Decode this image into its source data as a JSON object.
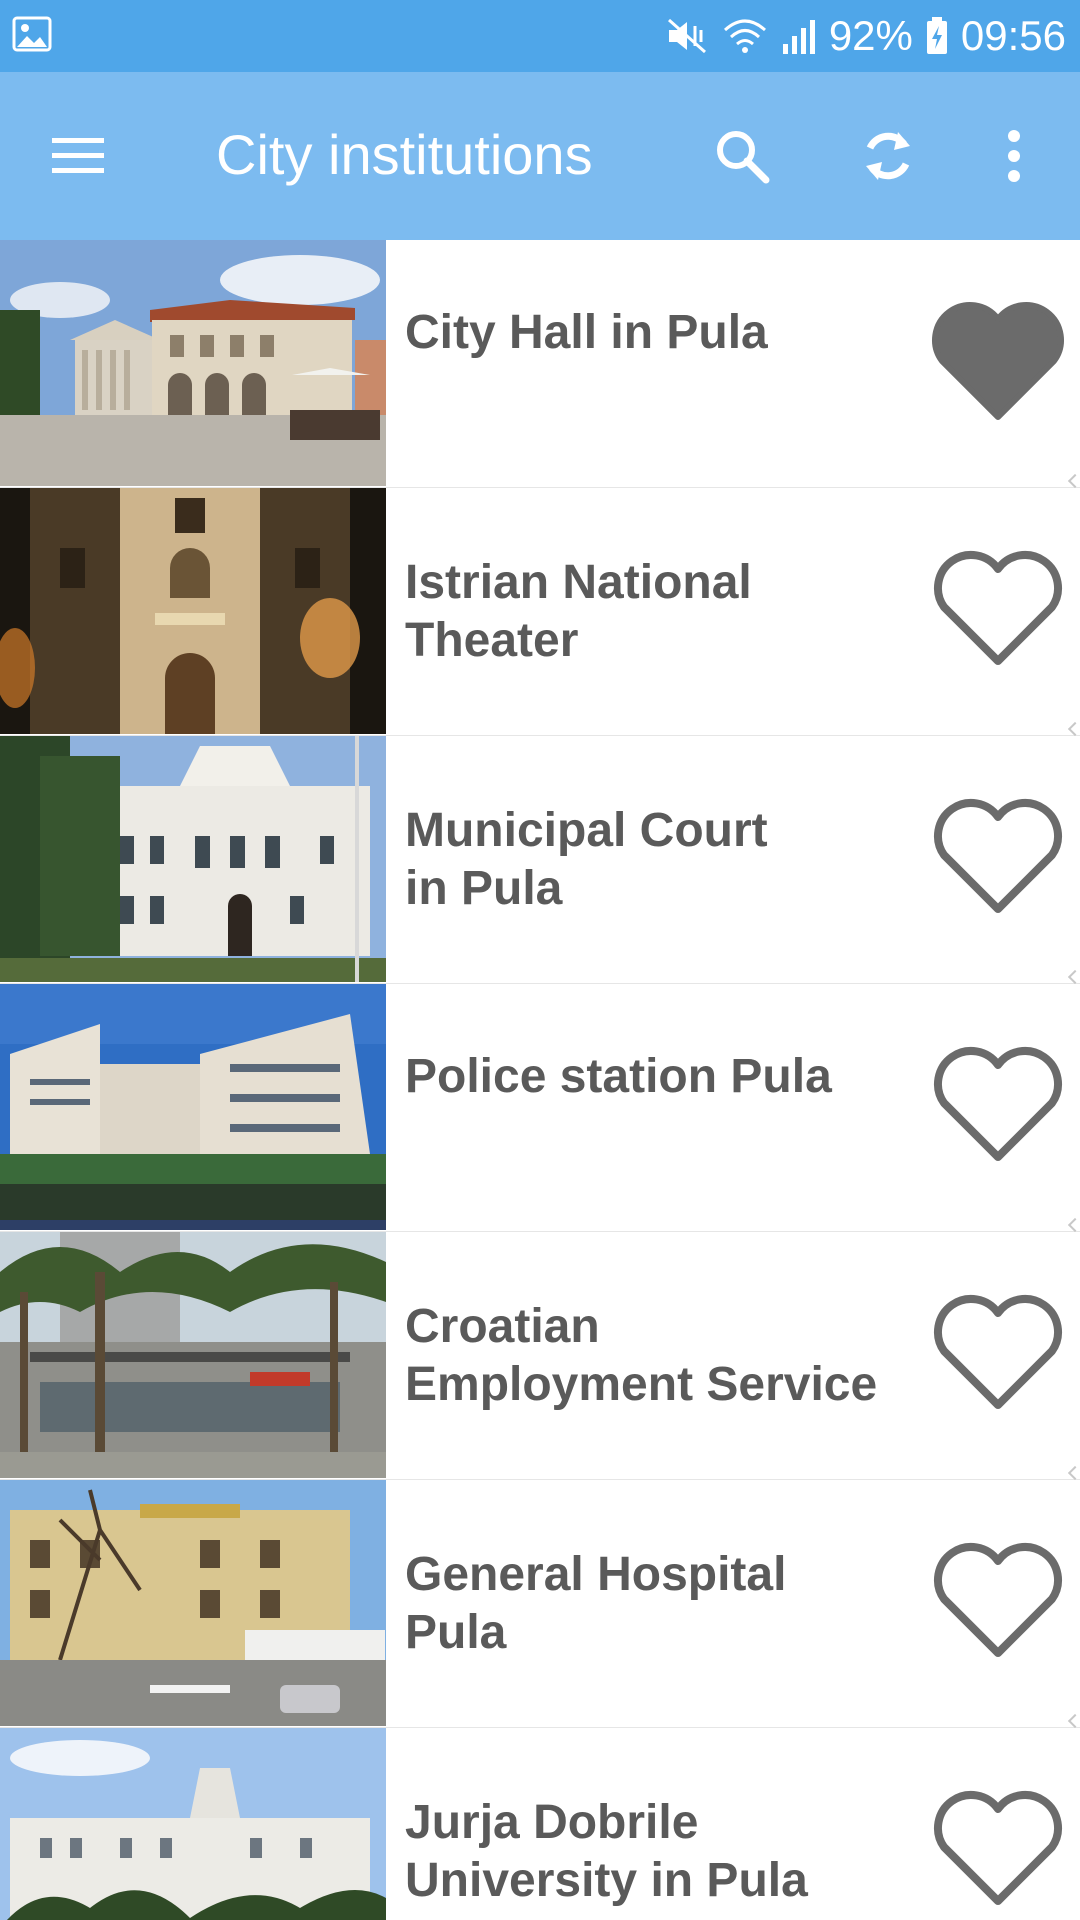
{
  "status_bar": {
    "battery": "92%",
    "time": "09:56",
    "icons": [
      "image-icon",
      "mute-vibrate-icon",
      "wifi-icon",
      "signal-icon",
      "battery-charging-icon"
    ]
  },
  "app_bar": {
    "title": "City institutions",
    "menu_icon": "hamburger-menu-icon",
    "search_icon": "search-icon",
    "refresh_icon": "refresh-icon",
    "more_icon": "more-vert-icon"
  },
  "colors": {
    "status_bar": "#4fa6e9",
    "app_bar": "#7cbbf0",
    "title_text": "#5a5a5a",
    "heart": "#6b6b6b"
  },
  "items": [
    {
      "title_lines": [
        "City Hall in Pula"
      ],
      "favorite": true
    },
    {
      "title_lines": [
        "Istrian National",
        "Theater"
      ],
      "favorite": false
    },
    {
      "title_lines": [
        "Municipal Court",
        "in Pula"
      ],
      "favorite": false
    },
    {
      "title_lines": [
        "Police station Pula"
      ],
      "favorite": false
    },
    {
      "title_lines": [
        "Croatian",
        "Employment Service"
      ],
      "favorite": false
    },
    {
      "title_lines": [
        "General Hospital",
        "Pula"
      ],
      "favorite": false
    },
    {
      "title_lines": [
        "Jurja Dobrile",
        "University in Pula"
      ],
      "favorite": false
    }
  ]
}
